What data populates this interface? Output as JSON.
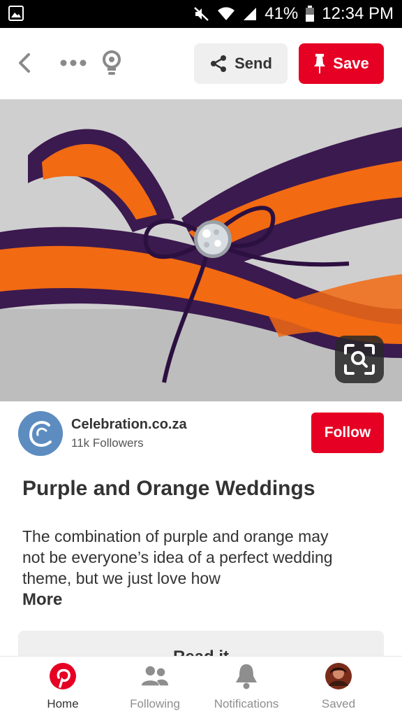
{
  "status_bar": {
    "battery": "41%",
    "time": "12:34 PM"
  },
  "toolbar": {
    "send_label": "Send",
    "save_label": "Save"
  },
  "creator": {
    "name": "Celebration.co.za",
    "followers": "11k Followers",
    "follow_label": "Follow"
  },
  "pin": {
    "title": "Purple and Orange Weddings",
    "description": "The combination of purple and orange may not be everyone’s idea of a perfect wedding theme, but we just love how",
    "more_label": "More",
    "read_it_label": "Read it"
  },
  "bottom_nav": {
    "items": [
      {
        "label": "Home",
        "icon": "pinterest-logo-icon",
        "active": true
      },
      {
        "label": "Following",
        "icon": "people-icon",
        "active": false
      },
      {
        "label": "Notifications",
        "icon": "bell-icon",
        "active": false
      },
      {
        "label": "Saved",
        "icon": "profile-avatar-icon",
        "active": false
      }
    ]
  },
  "colors": {
    "brand_red": "#e60023",
    "purple": "#3b1a4f",
    "orange": "#f26a12"
  }
}
